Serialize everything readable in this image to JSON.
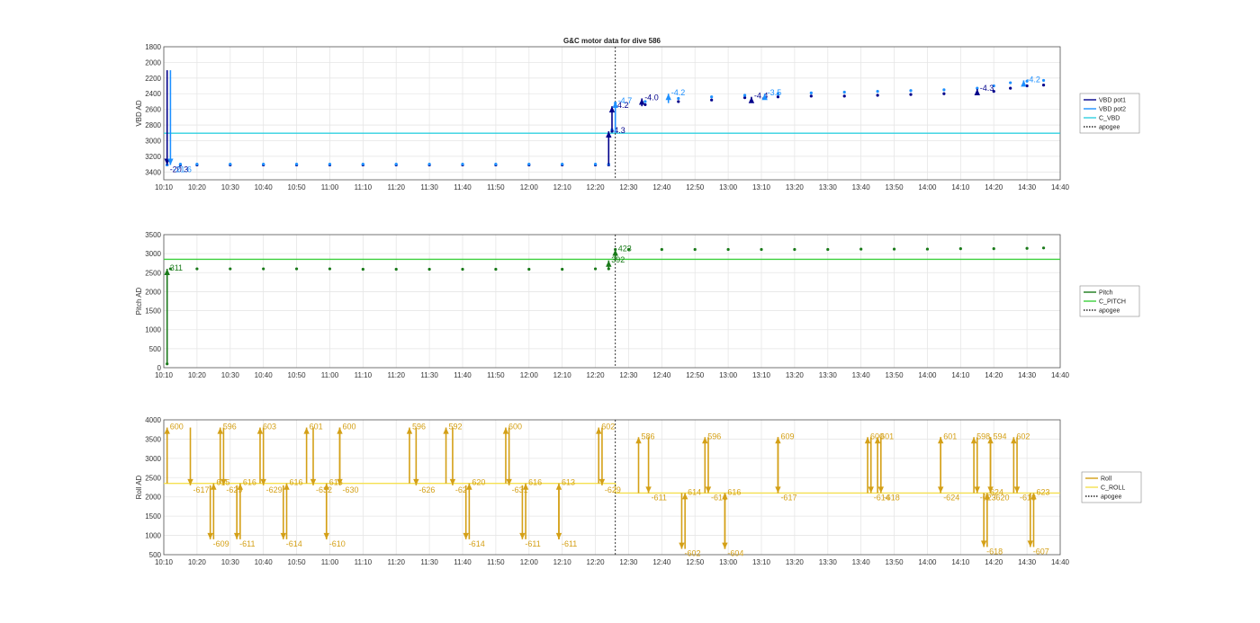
{
  "figure": {
    "title": "G&C motor data for dive 586",
    "time_ticks": [
      "10:10",
      "10:20",
      "10:30",
      "10:40",
      "10:50",
      "11:00",
      "11:10",
      "11:20",
      "11:30",
      "11:40",
      "11:50",
      "12:00",
      "12:10",
      "12:20",
      "12:30",
      "12:40",
      "12:50",
      "13:00",
      "13:10",
      "13:20",
      "13:30",
      "13:40",
      "13:50",
      "14:00",
      "14:10",
      "14:20",
      "14:30",
      "14:40"
    ],
    "apogee_time": "12:26"
  },
  "chart_data": [
    {
      "type": "line",
      "panel": "vbd",
      "title": "G&C motor data for dive 586",
      "xlabel": "",
      "ylabel": "VBD AD",
      "xlim": [
        "10:10",
        "14:40"
      ],
      "ylim": [
        3500,
        1800
      ],
      "y_reversed": true,
      "yticks": [
        1800,
        2000,
        2200,
        2400,
        2600,
        2800,
        3000,
        3200,
        3400
      ],
      "grid": true,
      "legend": {
        "placement": "outside-right",
        "entries": [
          {
            "name": "VBD pot1",
            "color": "#00008b",
            "style": "solid"
          },
          {
            "name": "VBD pot2",
            "color": "#1e90ff",
            "style": "solid"
          },
          {
            "name": "C_VBD",
            "color": "#30d0e0",
            "style": "solid"
          },
          {
            "name": "apogee",
            "color": "#222222",
            "style": "dotted"
          }
        ]
      },
      "series": [
        {
          "name": "VBD pot1",
          "color": "#00008b",
          "times": [
            "10:11",
            "10:15",
            "10:20",
            "10:30",
            "10:40",
            "10:50",
            "11:00",
            "11:10",
            "11:20",
            "11:30",
            "11:40",
            "11:50",
            "12:00",
            "12:10",
            "12:20",
            "12:24",
            "12:25",
            "12:26",
            "12:35",
            "12:45",
            "12:55",
            "13:05",
            "13:15",
            "13:25",
            "13:35",
            "13:45",
            "13:55",
            "14:05",
            "14:15",
            "14:20",
            "14:25",
            "14:30",
            "14:35"
          ],
          "values": [
            3310,
            3310,
            3310,
            3310,
            3310,
            3310,
            3310,
            3310,
            3310,
            3310,
            3310,
            3310,
            3310,
            3310,
            3310,
            3310,
            2880,
            2560,
            2540,
            2500,
            2480,
            2450,
            2440,
            2430,
            2430,
            2420,
            2410,
            2400,
            2390,
            2370,
            2330,
            2300,
            2290
          ]
        },
        {
          "name": "VBD pot2",
          "color": "#1e90ff",
          "times": [
            "10:11",
            "10:15",
            "10:20",
            "10:30",
            "10:40",
            "10:50",
            "11:00",
            "11:10",
            "11:20",
            "11:30",
            "11:40",
            "11:50",
            "12:00",
            "12:10",
            "12:20",
            "12:24",
            "12:25",
            "12:26",
            "12:35",
            "12:45",
            "12:55",
            "13:05",
            "13:15",
            "13:25",
            "13:35",
            "13:45",
            "13:55",
            "14:05",
            "14:15",
            "14:20",
            "14:25",
            "14:30",
            "14:35"
          ],
          "values": [
            3310,
            3300,
            3300,
            3300,
            3300,
            3300,
            3300,
            3300,
            3300,
            3300,
            3300,
            3300,
            3300,
            3300,
            3300,
            3300,
            2860,
            2520,
            2500,
            2460,
            2440,
            2420,
            2400,
            2390,
            2380,
            2370,
            2360,
            2350,
            2330,
            2300,
            2260,
            2240,
            2230
          ]
        },
        {
          "name": "C_VBD",
          "color": "#30d0e0",
          "times": [
            "10:10",
            "14:40"
          ],
          "values": [
            2905,
            2905
          ]
        }
      ],
      "moves": [
        {
          "time": "10:11",
          "from": 2100,
          "to": 3310,
          "label": "-20.3",
          "color": "#00008b"
        },
        {
          "time": "10:12",
          "from": 2100,
          "to": 3310,
          "label": "-21.6",
          "color": "#1e90ff"
        },
        {
          "time": "12:24",
          "from": 3310,
          "to": 2880,
          "label": "-4.3",
          "color": "#00008b"
        },
        {
          "time": "12:25",
          "from": 2880,
          "to": 2560,
          "label": "-4.2",
          "color": "#00008b"
        },
        {
          "time": "12:26",
          "from": 2900,
          "to": 2500,
          "label": "-4.7",
          "color": "#1e90ff"
        },
        {
          "time": "12:34",
          "from": 2560,
          "to": 2460,
          "label": "-4.0",
          "color": "#00008b"
        },
        {
          "time": "12:42",
          "from": 2520,
          "to": 2400,
          "label": "-4.2",
          "color": "#1e90ff"
        },
        {
          "time": "13:07",
          "from": 2480,
          "to": 2440,
          "label": "-4.4",
          "color": "#00008b"
        },
        {
          "time": "13:11",
          "from": 2450,
          "to": 2400,
          "label": "-3.5",
          "color": "#1e90ff"
        },
        {
          "time": "14:15",
          "from": 2400,
          "to": 2340,
          "label": "-4.3",
          "color": "#00008b"
        },
        {
          "time": "14:29",
          "from": 2290,
          "to": 2230,
          "label": "-4.2",
          "color": "#1e90ff"
        }
      ]
    },
    {
      "type": "line",
      "panel": "pitch",
      "xlabel": "",
      "ylabel": "Pitch AD",
      "xlim": [
        "10:10",
        "14:40"
      ],
      "ylim": [
        0,
        3500
      ],
      "yticks": [
        0,
        500,
        1000,
        1500,
        2000,
        2500,
        3000,
        3500
      ],
      "grid": true,
      "legend": {
        "placement": "outside-right",
        "entries": [
          {
            "name": "Pitch",
            "color": "#1a7a1a",
            "style": "solid"
          },
          {
            "name": "C_PITCH",
            "color": "#3ccf3c",
            "style": "solid"
          },
          {
            "name": "apogee",
            "color": "#222222",
            "style": "dotted"
          }
        ]
      },
      "series": [
        {
          "name": "Pitch",
          "color": "#1a7a1a",
          "times": [
            "10:11",
            "10:12",
            "10:20",
            "10:30",
            "10:40",
            "10:50",
            "11:00",
            "11:10",
            "11:20",
            "11:30",
            "11:40",
            "11:50",
            "12:00",
            "12:10",
            "12:20",
            "12:24",
            "12:26",
            "12:30",
            "12:40",
            "12:50",
            "13:00",
            "13:10",
            "13:20",
            "13:30",
            "13:40",
            "13:50",
            "14:00",
            "14:10",
            "14:20",
            "14:30",
            "14:35"
          ],
          "values": [
            100,
            2600,
            2600,
            2600,
            2600,
            2600,
            2600,
            2590,
            2590,
            2590,
            2590,
            2590,
            2590,
            2590,
            2600,
            2600,
            3110,
            3110,
            3110,
            3110,
            3110,
            3110,
            3110,
            3110,
            3120,
            3120,
            3120,
            3130,
            3130,
            3140,
            3150
          ]
        },
        {
          "name": "C_PITCH",
          "color": "#3ccf3c",
          "times": [
            "10:10",
            "14:40"
          ],
          "values": [
            2850,
            2850
          ]
        }
      ],
      "moves": [
        {
          "time": "10:11",
          "from": 100,
          "to": 2600,
          "label": "311",
          "color": "#1a7a1a"
        },
        {
          "time": "12:24",
          "from": 2600,
          "to": 2820,
          "label": "392",
          "color": "#1a7a1a"
        },
        {
          "time": "12:26",
          "from": 2820,
          "to": 3110,
          "label": "423",
          "color": "#1a7a1a"
        }
      ]
    },
    {
      "type": "line",
      "panel": "roll",
      "xlabel": "",
      "ylabel": "Roll AD",
      "xlim": [
        "10:10",
        "14:40"
      ],
      "ylim": [
        500,
        4000
      ],
      "yticks": [
        500,
        1000,
        1500,
        2000,
        2500,
        3000,
        3500,
        4000
      ],
      "grid": true,
      "legend": {
        "placement": "outside-right",
        "entries": [
          {
            "name": "Roll",
            "color": "#d4a017",
            "style": "solid"
          },
          {
            "name": "C_ROLL",
            "color": "#f5e050",
            "style": "solid"
          },
          {
            "name": "apogee",
            "color": "#222222",
            "style": "dotted"
          }
        ]
      },
      "series": [
        {
          "name": "C_ROLL",
          "color": "#f5e050",
          "times": [
            "10:10",
            "12:26",
            "12:26",
            "14:40"
          ],
          "values": [
            2350,
            2350,
            2100,
            2100
          ]
        }
      ],
      "moves": [
        {
          "time": "10:11",
          "from": 2350,
          "to": 3800,
          "label": "600",
          "up": true
        },
        {
          "time": "10:18",
          "from": 3800,
          "to": 2300,
          "label": "-617",
          "up": false
        },
        {
          "time": "10:24",
          "from": 2300,
          "to": 900,
          "label": "-609",
          "up": false
        },
        {
          "time": "10:25",
          "from": 900,
          "to": 2350,
          "label": "615",
          "up": true
        },
        {
          "time": "10:27",
          "from": 2350,
          "to": 3800,
          "label": "596",
          "up": true
        },
        {
          "time": "10:28",
          "from": 3800,
          "to": 2300,
          "label": "-629",
          "up": false
        },
        {
          "time": "10:32",
          "from": 2300,
          "to": 900,
          "label": "-611",
          "up": false
        },
        {
          "time": "10:33",
          "from": 900,
          "to": 2350,
          "label": "616",
          "up": true
        },
        {
          "time": "10:39",
          "from": 2350,
          "to": 3800,
          "label": "603",
          "up": true
        },
        {
          "time": "10:40",
          "from": 3800,
          "to": 2300,
          "label": "-629",
          "up": false
        },
        {
          "time": "10:46",
          "from": 2300,
          "to": 900,
          "label": "-614",
          "up": false
        },
        {
          "time": "10:47",
          "from": 900,
          "to": 2350,
          "label": "616",
          "up": true
        },
        {
          "time": "10:53",
          "from": 2350,
          "to": 3800,
          "label": "601",
          "up": true
        },
        {
          "time": "10:55",
          "from": 3800,
          "to": 2300,
          "label": "-632",
          "up": false
        },
        {
          "time": "10:59",
          "from": 2300,
          "to": 900,
          "label": "-610",
          "up": false
        },
        {
          "time": "10:59",
          "from": 900,
          "to": 2350,
          "label": "615",
          "up": true
        },
        {
          "time": "11:03",
          "from": 2350,
          "to": 3800,
          "label": "600",
          "up": true
        },
        {
          "time": "11:03",
          "from": 3800,
          "to": 2300,
          "label": "-630",
          "up": false
        },
        {
          "time": "11:24",
          "from": 2350,
          "to": 3800,
          "label": "596",
          "up": true
        },
        {
          "time": "11:26",
          "from": 3800,
          "to": 2300,
          "label": "-626",
          "up": false
        },
        {
          "time": "11:35",
          "from": 2350,
          "to": 3800,
          "label": "592",
          "up": true
        },
        {
          "time": "11:37",
          "from": 3800,
          "to": 2300,
          "label": "-627",
          "up": false
        },
        {
          "time": "11:41",
          "from": 2300,
          "to": 900,
          "label": "-614",
          "up": false
        },
        {
          "time": "11:42",
          "from": 900,
          "to": 2350,
          "label": "620",
          "up": true
        },
        {
          "time": "11:53",
          "from": 2350,
          "to": 3800,
          "label": "600",
          "up": true
        },
        {
          "time": "11:54",
          "from": 3800,
          "to": 2300,
          "label": "-631",
          "up": false
        },
        {
          "time": "11:58",
          "from": 2300,
          "to": 900,
          "label": "-611",
          "up": false
        },
        {
          "time": "11:59",
          "from": 900,
          "to": 2350,
          "label": "616",
          "up": true
        },
        {
          "time": "12:09",
          "from": 2300,
          "to": 900,
          "label": "-611",
          "up": false
        },
        {
          "time": "12:09",
          "from": 900,
          "to": 2350,
          "label": "613",
          "up": true
        },
        {
          "time": "12:21",
          "from": 2350,
          "to": 3800,
          "label": "602",
          "up": true
        },
        {
          "time": "12:22",
          "from": 3800,
          "to": 2300,
          "label": "-629",
          "up": false
        },
        {
          "time": "12:33",
          "from": 2100,
          "to": 3550,
          "label": "586",
          "up": true
        },
        {
          "time": "12:36",
          "from": 3550,
          "to": 2100,
          "label": "-611",
          "up": false
        },
        {
          "time": "12:46",
          "from": 2100,
          "to": 650,
          "label": "-602",
          "up": false
        },
        {
          "time": "12:47",
          "from": 650,
          "to": 2100,
          "label": "614",
          "up": true
        },
        {
          "time": "12:53",
          "from": 2100,
          "to": 3550,
          "label": "596",
          "up": true
        },
        {
          "time": "12:54",
          "from": 3550,
          "to": 2100,
          "label": "-616",
          "up": false
        },
        {
          "time": "12:59",
          "from": 2100,
          "to": 650,
          "label": "-604",
          "up": false
        },
        {
          "time": "12:59",
          "from": 650,
          "to": 2100,
          "label": "616",
          "up": true
        },
        {
          "time": "13:15",
          "from": 2100,
          "to": 3550,
          "label": "609",
          "up": true
        },
        {
          "time": "13:15",
          "from": 3550,
          "to": 2100,
          "label": "-617",
          "up": false
        },
        {
          "time": "13:42",
          "from": 2100,
          "to": 3550,
          "label": "600",
          "up": true
        },
        {
          "time": "13:43",
          "from": 3550,
          "to": 2100,
          "label": "-614",
          "up": false
        },
        {
          "time": "13:45",
          "from": 2100,
          "to": 3550,
          "label": "601",
          "up": true
        },
        {
          "time": "13:46",
          "from": 3550,
          "to": 2100,
          "label": "-618",
          "up": false
        },
        {
          "time": "14:04",
          "from": 2100,
          "to": 3550,
          "label": "601",
          "up": true
        },
        {
          "time": "14:04",
          "from": 3550,
          "to": 2100,
          "label": "-624",
          "up": false
        },
        {
          "time": "14:14",
          "from": 2100,
          "to": 3550,
          "label": "598",
          "up": true
        },
        {
          "time": "14:15",
          "from": 3550,
          "to": 2100,
          "label": "-623",
          "up": false
        },
        {
          "time": "14:17",
          "from": 2100,
          "to": 700,
          "label": "-618",
          "up": false
        },
        {
          "time": "14:18",
          "from": 700,
          "to": 2100,
          "label": "624",
          "up": true
        },
        {
          "time": "14:19",
          "from": 2100,
          "to": 3550,
          "label": "594",
          "up": true
        },
        {
          "time": "14:19",
          "from": 3550,
          "to": 2100,
          "label": "-620",
          "up": false
        },
        {
          "time": "14:26",
          "from": 2100,
          "to": 3550,
          "label": "602",
          "up": true
        },
        {
          "time": "14:27",
          "from": 3550,
          "to": 2100,
          "label": "-613",
          "up": false
        },
        {
          "time": "14:31",
          "from": 2100,
          "to": 700,
          "label": "-607",
          "up": false
        },
        {
          "time": "14:32",
          "from": 700,
          "to": 2100,
          "label": "623",
          "up": true
        }
      ]
    }
  ]
}
